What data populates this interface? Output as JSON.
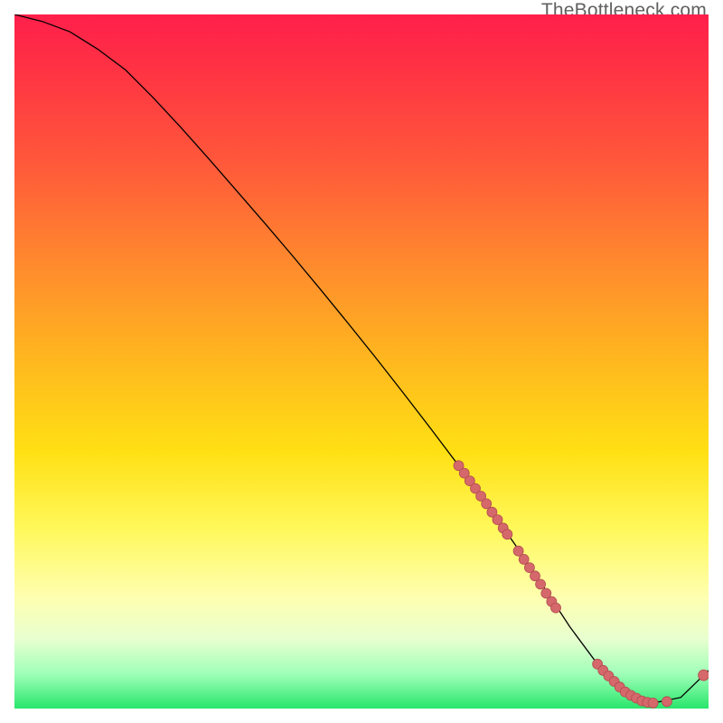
{
  "watermark": "TheBottleneck.com",
  "colors": {
    "grad_top": "#ff1f4b",
    "grad_mid_orange": "#ff8a2d",
    "grad_yellow": "#ffe014",
    "grad_bottom": "#28e66b",
    "curve": "#000000",
    "dot_fill": "#d5686b",
    "dot_stroke": "#b24d50"
  },
  "chart_data": {
    "type": "line",
    "title": "",
    "xlabel": "",
    "ylabel": "",
    "xlim": [
      0,
      100
    ],
    "ylim": [
      0,
      100
    ],
    "grid": false,
    "legend": false,
    "series": [
      {
        "name": "bottleneck-curve",
        "x": [
          0,
          4,
          8,
          12,
          16,
          20,
          24,
          28,
          32,
          36,
          40,
          44,
          48,
          52,
          56,
          60,
          64,
          68,
          72,
          76,
          80,
          84,
          88,
          92,
          96,
          100
        ],
        "y": [
          100,
          99,
          97.5,
          95,
          92,
          88,
          83.7,
          79.2,
          74.6,
          70,
          65.3,
          60.5,
          55.6,
          50.6,
          45.5,
          40.3,
          35,
          29.5,
          23.8,
          17.9,
          11.8,
          6.4,
          2.4,
          0.8,
          1.6,
          5.5
        ]
      }
    ],
    "markers": [
      {
        "name": "highlight-cluster-upper",
        "x": [
          64.0,
          64.8,
          65.6,
          66.4,
          67.2,
          68.0,
          68.8,
          69.6,
          70.4,
          71.0,
          72.6,
          73.4,
          74.2,
          75.0,
          75.8,
          76.6,
          77.4,
          78.0
        ],
        "y": [
          35.0,
          33.9,
          32.8,
          31.7,
          30.6,
          29.5,
          28.3,
          27.2,
          26.0,
          25.1,
          22.7,
          21.5,
          20.3,
          19.1,
          17.9,
          16.6,
          15.4,
          14.5
        ]
      },
      {
        "name": "highlight-cluster-lower",
        "x": [
          84.0,
          84.8,
          85.6,
          86.4,
          87.2,
          88.0,
          88.8,
          89.6,
          90.4,
          91.2,
          92.0,
          94.0
        ],
        "y": [
          6.4,
          5.5,
          4.7,
          3.9,
          3.1,
          2.4,
          1.9,
          1.5,
          1.1,
          0.9,
          0.8,
          1.0
        ]
      },
      {
        "name": "highlight-tail-tip",
        "x": [
          99.3
        ],
        "y": [
          4.8
        ]
      }
    ]
  }
}
